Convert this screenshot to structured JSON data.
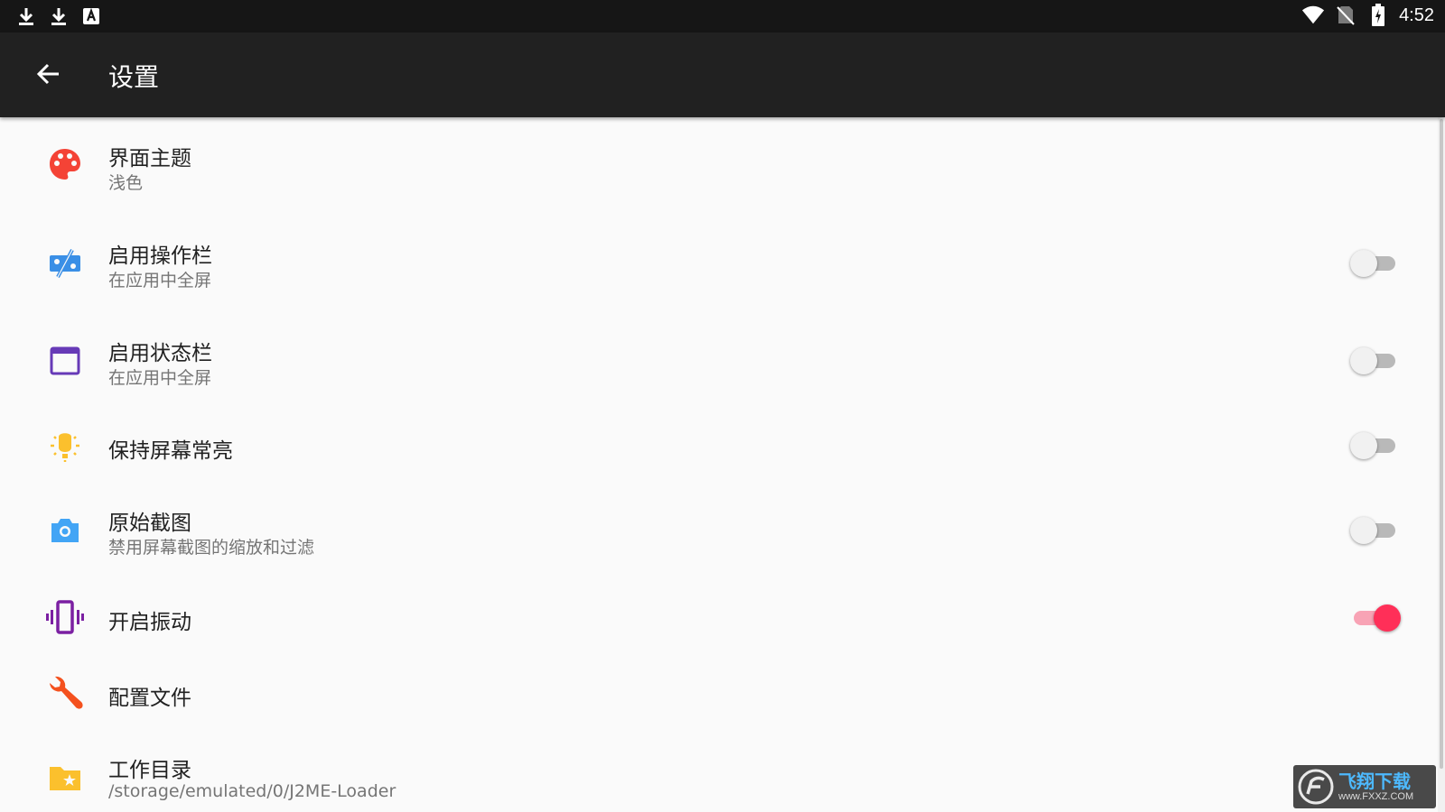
{
  "status_bar": {
    "time": "4:52",
    "left_icons": [
      "download-icon",
      "download-icon",
      "text-app-icon"
    ],
    "right_icons": [
      "wifi-icon",
      "no-sim-icon",
      "battery-charging-icon"
    ]
  },
  "app_bar": {
    "back_icon": "arrow-back-icon",
    "title": "设置"
  },
  "settings": [
    {
      "id": "theme",
      "title": "界面主题",
      "subtitle": "浅色",
      "icon": "palette-icon",
      "icon_color": "#f44336"
    },
    {
      "id": "action-bar",
      "title": "启用操作栏",
      "subtitle": "在应用中全屏",
      "icon": "percent-tag-icon",
      "icon_color": "#3a8fe6",
      "toggle": false
    },
    {
      "id": "status-bar",
      "title": "启用状态栏",
      "subtitle": "在应用中全屏",
      "icon": "window-icon",
      "icon_color": "#673ab7",
      "toggle": false
    },
    {
      "id": "keep-screen-on",
      "title": "保持屏幕常亮",
      "subtitle": "",
      "icon": "lightbulb-icon",
      "icon_color": "#fbc02d",
      "toggle": false
    },
    {
      "id": "raw-screenshot",
      "title": "原始截图",
      "subtitle": "禁用屏幕截图的缩放和过滤",
      "icon": "camera-icon",
      "icon_color": "#42a5f5",
      "toggle": false
    },
    {
      "id": "vibration",
      "title": "开启振动",
      "subtitle": "",
      "icon": "vibrate-icon",
      "icon_color": "#7b1fa2",
      "toggle": true
    },
    {
      "id": "profiles",
      "title": "配置文件",
      "subtitle": "",
      "icon": "wrench-icon",
      "icon_color": "#f4511e"
    },
    {
      "id": "working-dir",
      "title": "工作目录",
      "subtitle": "/storage/emulated/0/J2ME-Loader",
      "icon": "folder-star-icon",
      "icon_color": "#fbc02d"
    }
  ],
  "watermark": {
    "main": "飞翔下载",
    "sub": "www.FXXZ.COM"
  },
  "colors": {
    "status_bar_bg": "#161616",
    "app_bar_bg": "#212121",
    "page_bg": "#fafafa",
    "switch_on": "#ff2f58"
  }
}
